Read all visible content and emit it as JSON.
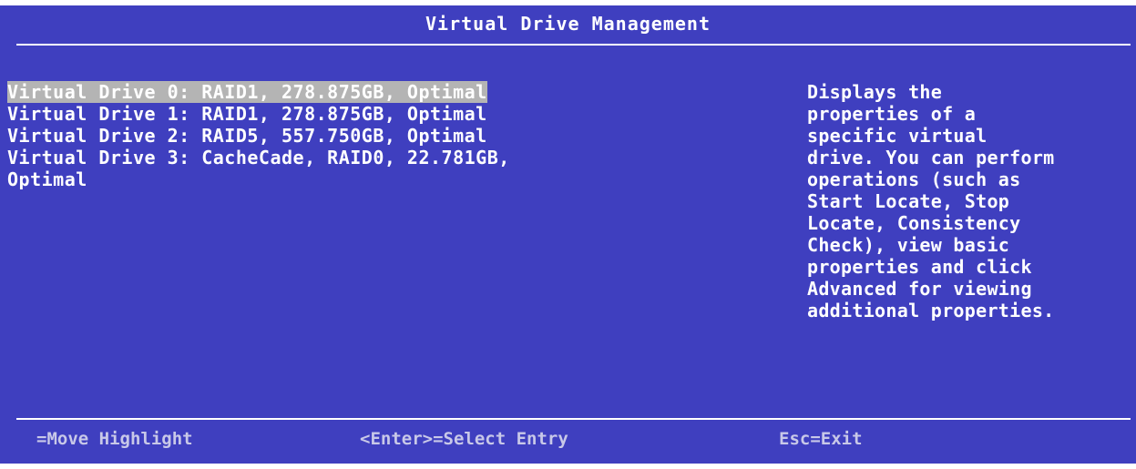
{
  "title": "Virtual Drive Management",
  "drives": [
    {
      "label": "Virtual Drive 0: RAID1, 278.875GB, Optimal"
    },
    {
      "label": "Virtual Drive 1: RAID1, 278.875GB, Optimal"
    },
    {
      "label": "Virtual Drive 2: RAID5, 557.750GB, Optimal"
    },
    {
      "label": "Virtual Drive 3: CacheCade, RAID0, 22.781GB,\nOptimal"
    }
  ],
  "help_text": "Displays the\nproperties of a\nspecific virtual\ndrive. You can perform\noperations (such as\nStart Locate, Stop\nLocate, Consistency\nCheck), view basic\nproperties and click\nAdvanced for viewing\nadditional properties.",
  "footer": {
    "move": "=Move Highlight",
    "select": "<Enter>=Select Entry",
    "exit": "Esc=Exit"
  },
  "colors": {
    "background": "#3f3fbf",
    "highlight": "#b4b4b4",
    "text": "#ffffff"
  }
}
